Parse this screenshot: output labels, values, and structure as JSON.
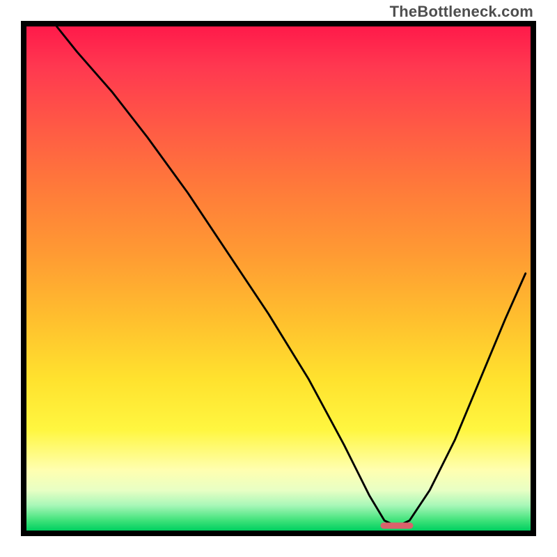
{
  "attribution": "TheBottleneck.com",
  "optimum_marker": {
    "x_pct": 73.5,
    "y_pct": 99.1,
    "width_pct": 6.5,
    "color": "#d9626b"
  },
  "chart_data": {
    "type": "line",
    "title": "",
    "xlabel": "",
    "ylabel": "",
    "xlim": [
      0,
      100
    ],
    "ylim": [
      0,
      100
    ],
    "grid": false,
    "legend": false,
    "background": "rainbow-gradient vertical (red at top → green at bottom)",
    "series": [
      {
        "name": "bottleneck-curve",
        "stroke": "#000000",
        "x": [
          6,
          10,
          17,
          24,
          32,
          40,
          48,
          56,
          63,
          68,
          71,
          73.5,
          76,
          80,
          85,
          90,
          95,
          99
        ],
        "y": [
          100,
          95,
          87,
          78,
          67,
          55,
          43,
          30,
          17,
          7,
          2,
          0.8,
          2,
          8,
          18,
          30,
          42,
          51
        ]
      }
    ],
    "notes": "y is measured from the bottom (0) to top (100). The curve descends steeply from top-left, flattens to a minimum around x≈73.5, then rises again toward the right. A small pink rounded marker sits on the baseline under the minimum."
  }
}
